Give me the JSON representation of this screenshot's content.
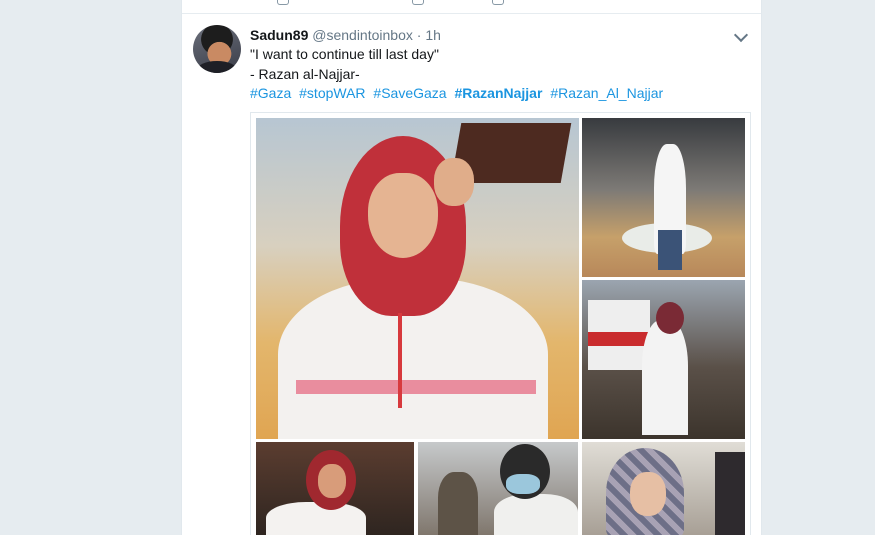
{
  "tweet": {
    "display_name": "Sadun89",
    "handle": "@sendintoinbox",
    "separator": " · ",
    "time": "1h",
    "line1": "\"I want to continue till last day\"",
    "line2": " - Razan al-Najjar-",
    "hashtags": [
      {
        "text": "#Gaza",
        "bold": false
      },
      {
        "text": "#stopWAR",
        "bold": false
      },
      {
        "text": "#SaveGaza",
        "bold": false
      },
      {
        "text": "#RazanNajjar",
        "bold": true
      },
      {
        "text": "#Razan_Al_Najjar",
        "bold": false
      }
    ],
    "link_color": "#1b95e0"
  },
  "icons": {
    "avatar": "user-avatar",
    "menu": "chevron-down-icon"
  },
  "media": {
    "photos": [
      "main-photo",
      "photo-smoke",
      "photo-ambulance",
      "photo-crying",
      "photo-mask",
      "photo-tired"
    ]
  }
}
